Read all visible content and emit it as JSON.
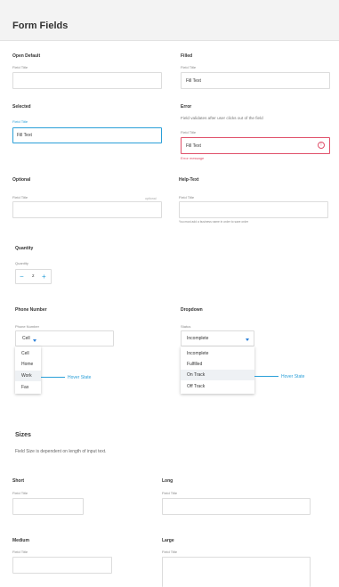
{
  "page": {
    "title": "Form Fields"
  },
  "open_default": {
    "heading": "Open Default",
    "label": "Field Title"
  },
  "filled": {
    "heading": "Filled",
    "label": "Field Title",
    "value": "Fill Text"
  },
  "selected": {
    "heading": "Selected",
    "label": "Field Title",
    "value": "Fill Text"
  },
  "error": {
    "heading": "Error",
    "note": "Field validates after user clicks out of the field",
    "label": "Field Title",
    "value": "Fill Text",
    "message": "Error message",
    "icon": "alert-circle-icon",
    "color": "#e0506a"
  },
  "optional": {
    "heading": "Optional",
    "label": "Field Title",
    "tag": "optional"
  },
  "help_text": {
    "heading": "Help-Text",
    "label": "Field Title",
    "help": "You must add a business name in order to save order"
  },
  "quantity": {
    "heading": "Quantity",
    "label": "Quantity",
    "value": "2",
    "minus": "−",
    "plus": "+"
  },
  "phone": {
    "heading": "Phone Number",
    "label": "Phone Number",
    "selected": "Cell",
    "options": [
      "Cell",
      "Home",
      "Work",
      "Fax"
    ],
    "hover_index": 2,
    "hover_label": "Hover State"
  },
  "dropdown": {
    "heading": "Dropdown",
    "label": "Status",
    "selected": "Incomplete",
    "options": [
      "Incomplete",
      "Fulfilled",
      "On Track",
      "Off Track"
    ],
    "hover_index": 2,
    "hover_label": "Hover State"
  },
  "sizes": {
    "heading": "Sizes",
    "note": "Field Size is dependent on length of input text.",
    "short": {
      "heading": "Short",
      "label": "Field Title"
    },
    "long": {
      "heading": "Long",
      "label": "Field Title"
    },
    "medium": {
      "heading": "Medium",
      "label": "Field Title"
    },
    "large": {
      "heading": "Large",
      "label": "Field Title"
    }
  },
  "colors": {
    "accent": "#2a9fd8",
    "error": "#e0506a",
    "border": "#dcdcdc"
  }
}
